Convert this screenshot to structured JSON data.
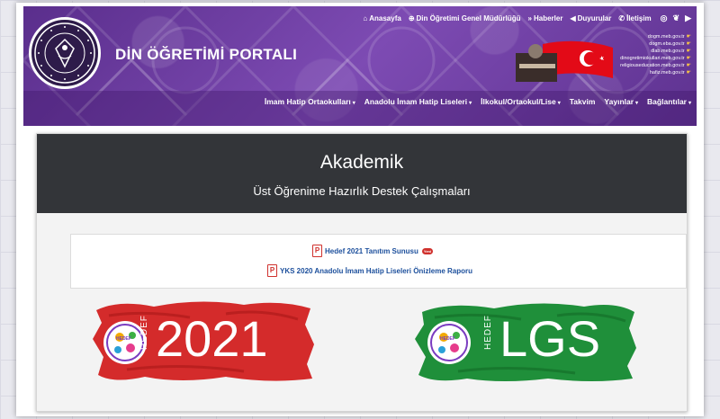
{
  "header": {
    "title": "DİN ÖĞRETİMİ PORTALI",
    "top_nav": [
      {
        "icon": "home-icon",
        "glyph": "⌂",
        "label": "Anasayfa"
      },
      {
        "icon": "globe-icon",
        "glyph": "⊕",
        "label": "Din Öğretimi Genel Müdürlüğü"
      },
      {
        "icon": "rss-icon",
        "glyph": "»",
        "label": "Haberler"
      },
      {
        "icon": "megaphone-icon",
        "glyph": "◀",
        "label": "Duyurular"
      },
      {
        "icon": "phone-icon",
        "glyph": "✆",
        "label": "İletişim"
      }
    ],
    "social": [
      {
        "icon": "instagram-icon",
        "glyph": "◎"
      },
      {
        "icon": "twitter-icon",
        "glyph": "❦"
      },
      {
        "icon": "youtube-icon",
        "glyph": "▶"
      }
    ],
    "links": [
      "dogm.meb.gov.tr",
      "dogm.eba.gov.tr",
      "dlab.meb.gov.tr",
      "dinogretimiokullari.meb.gov.tr",
      "religiouseducation.meb.gov.tr",
      "hafiz.meb.gov.tr"
    ],
    "main_nav": [
      {
        "label": "İmam Hatip Ortaokulları",
        "dropdown": true
      },
      {
        "label": "Anadolu İmam Hatip Liseleri",
        "dropdown": true
      },
      {
        "label": "İlkokul/Ortaokul/Lise",
        "dropdown": true
      },
      {
        "label": "Takvim",
        "dropdown": false
      },
      {
        "label": "Yayınlar",
        "dropdown": true
      },
      {
        "label": "Bağlantılar",
        "dropdown": true
      }
    ]
  },
  "panel": {
    "title": "Akademik",
    "subtitle": "Üst Öğrenime Hazırlık Destek Çalışmaları",
    "documents": [
      {
        "label": "Hedef 2021 Tanıtım Sunusu",
        "badge": "Yeni",
        "icon": "pdf-icon"
      },
      {
        "label": "YKS 2020 Anadolu İmam Hatip Liseleri Önizleme Raporu",
        "icon": "pdf-icon"
      }
    ]
  },
  "banners": {
    "left": {
      "small": "HEDEF",
      "big": "2021",
      "logo_top": "HEDEF",
      "color": "#d42b2b"
    },
    "right": {
      "small": "HEDEF",
      "big": "LGS",
      "logo_top": "HEDEF",
      "color": "#1f8f3a"
    }
  },
  "colors": {
    "header_purple": "#6b3fa0",
    "panel_head": "#333539",
    "link_blue": "#1c4f9c",
    "pdf_red": "#d0312d"
  }
}
